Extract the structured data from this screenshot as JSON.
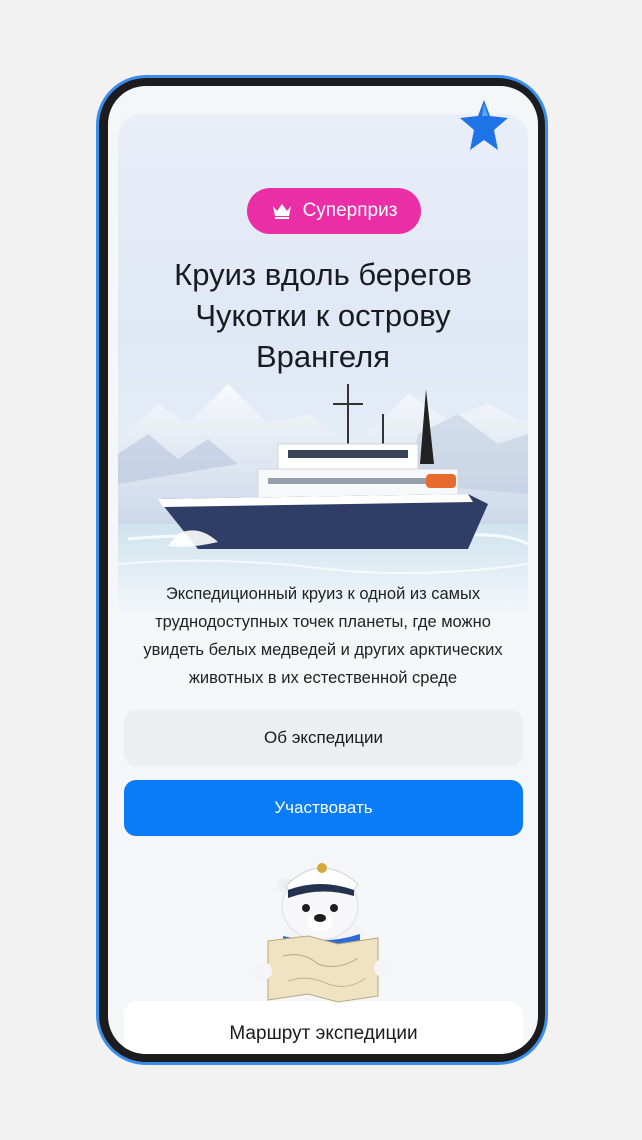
{
  "badge": {
    "label": "Суперприз",
    "icon": "crown-icon",
    "color": "#ea2fa6"
  },
  "hero": {
    "title": "Круиз вдоль берегов Чукотки к острову Врангеля"
  },
  "description": "Экспедиционный круиз к одной из самых труднодоступных точек планеты, где можно увидеть белых медведей и других арктических животных в их естественной среде",
  "buttons": {
    "about": "Об экспедиции",
    "participate": "Участвовать"
  },
  "route_card": {
    "title": "Маршрут экспедиции"
  },
  "colors": {
    "accent_blue": "#0a7cf7",
    "phone_frame": "#3a8eec",
    "badge_pink": "#ea2fa6"
  }
}
